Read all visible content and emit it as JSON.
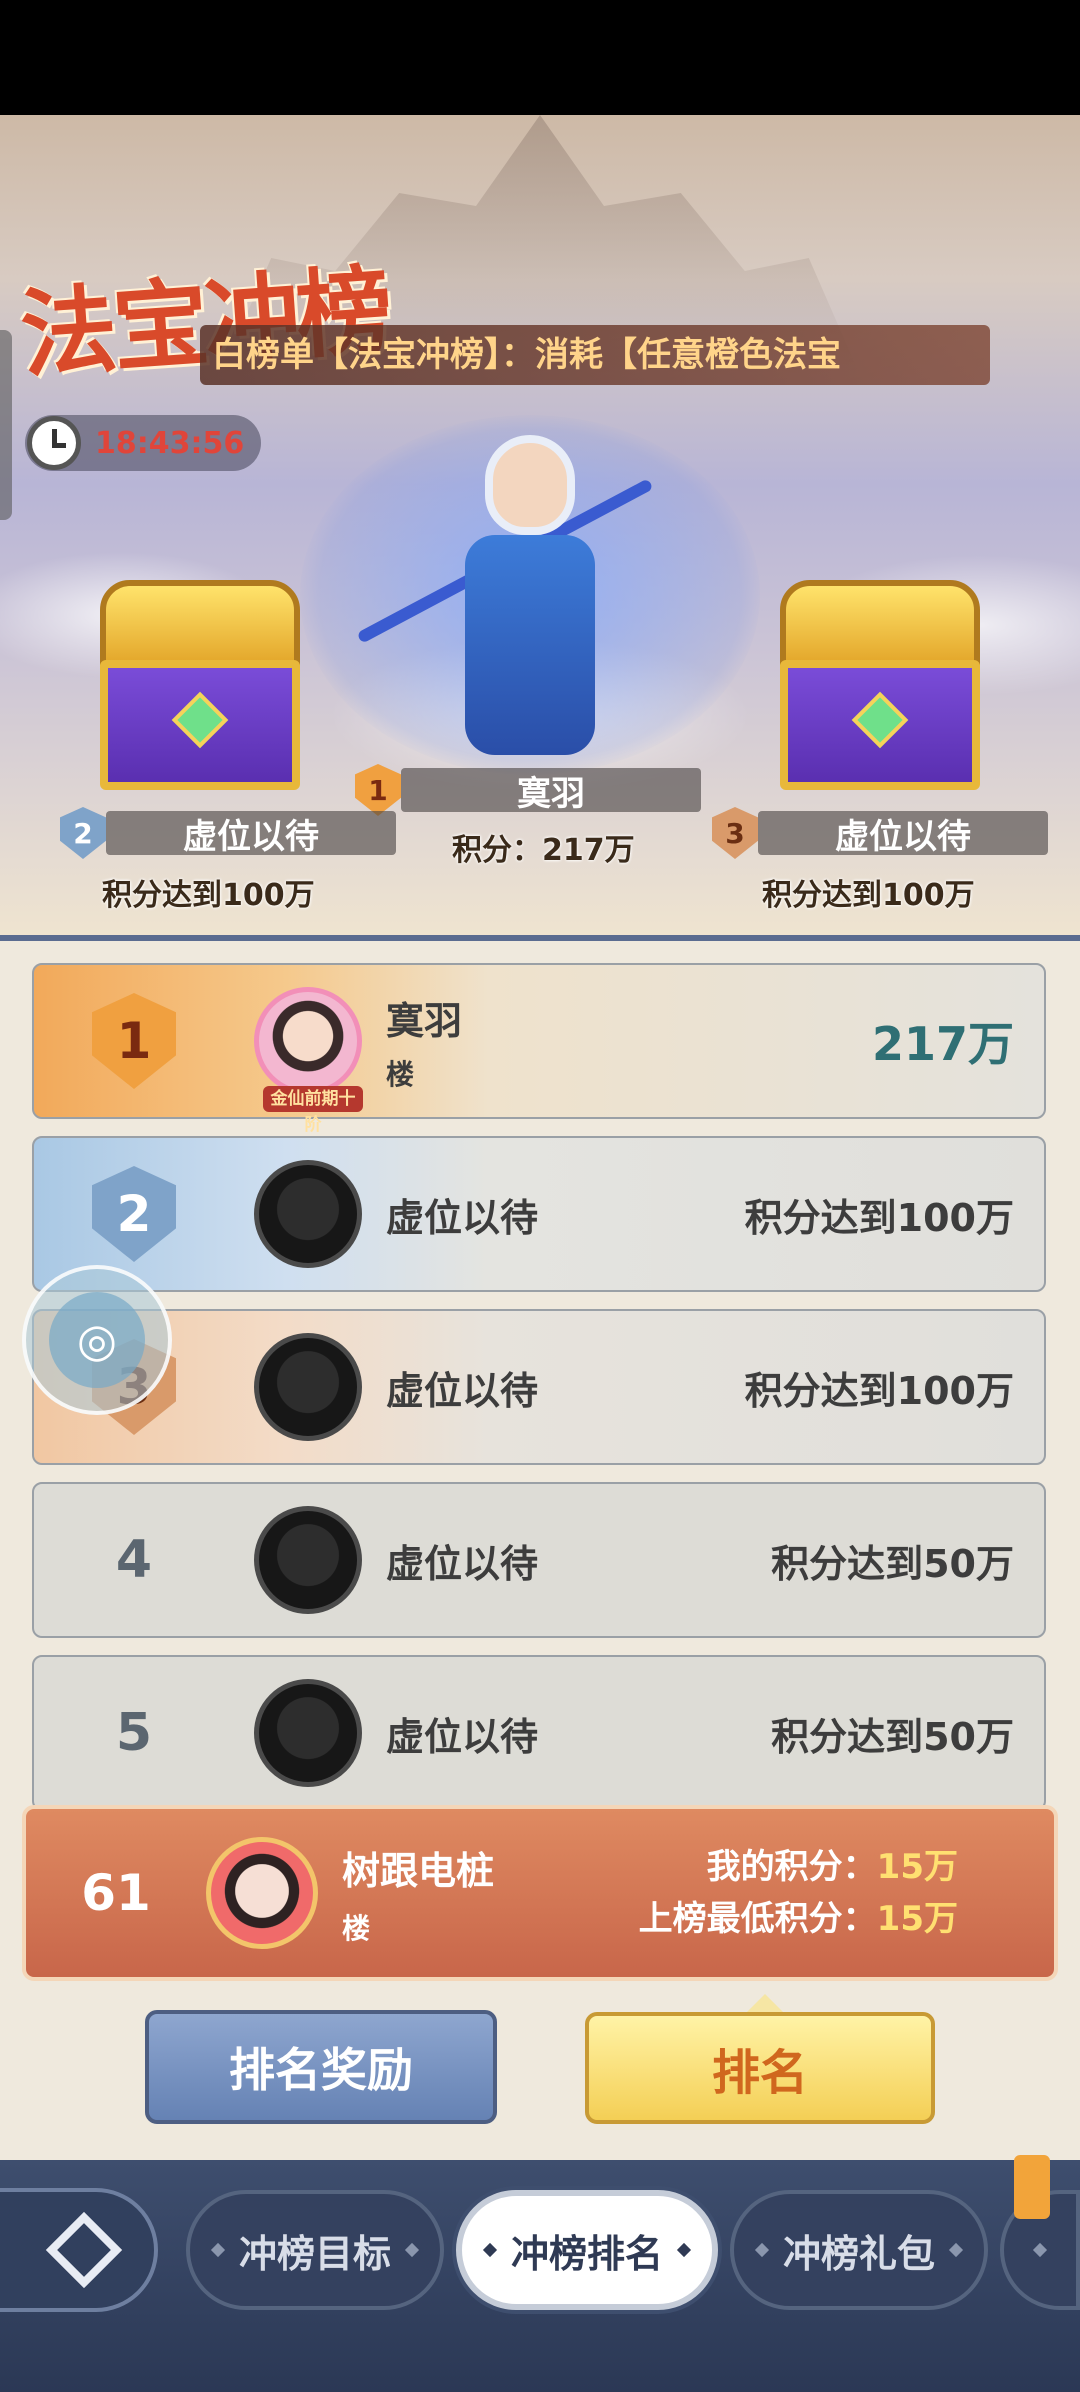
{
  "banner": {
    "title_art": "法宝冲榜",
    "marquee": "白榜单【法宝冲榜】：消耗【任意橙色法宝",
    "timer": "18:43:56"
  },
  "podium": {
    "first": {
      "rank": "1",
      "name": "寞羽",
      "score_label": "积分：217万"
    },
    "second": {
      "rank": "2",
      "name": "虚位以待",
      "requirement": "积分达到100万"
    },
    "third": {
      "rank": "3",
      "name": "虚位以待",
      "requirement": "积分达到100万"
    }
  },
  "ranking": {
    "rows": [
      {
        "rank": "1",
        "name": "寞羽",
        "server": "楼",
        "score": "217万",
        "title_tag": "金仙前期十阶"
      },
      {
        "rank": "2",
        "name": "虚位以待",
        "score": "积分达到100万"
      },
      {
        "rank": "3",
        "name": "虚位以待",
        "score": "积分达到100万"
      },
      {
        "rank": "4",
        "name": "虚位以待",
        "score": "积分达到50万"
      },
      {
        "rank": "5",
        "name": "虚位以待",
        "score": "积分达到50万"
      }
    ]
  },
  "my_rank": {
    "rank": "61",
    "name": "树跟电桩",
    "server": "楼",
    "my_score_label": "我的积分：",
    "my_score": "15万",
    "min_score_label": "上榜最低积分：",
    "min_score": "15万"
  },
  "actions": {
    "reward_label": "排名奖励",
    "rank_label": "排名"
  },
  "nav": {
    "tab1": "冲榜目标",
    "tab2": "冲榜排名",
    "tab3": "冲榜礼包"
  }
}
